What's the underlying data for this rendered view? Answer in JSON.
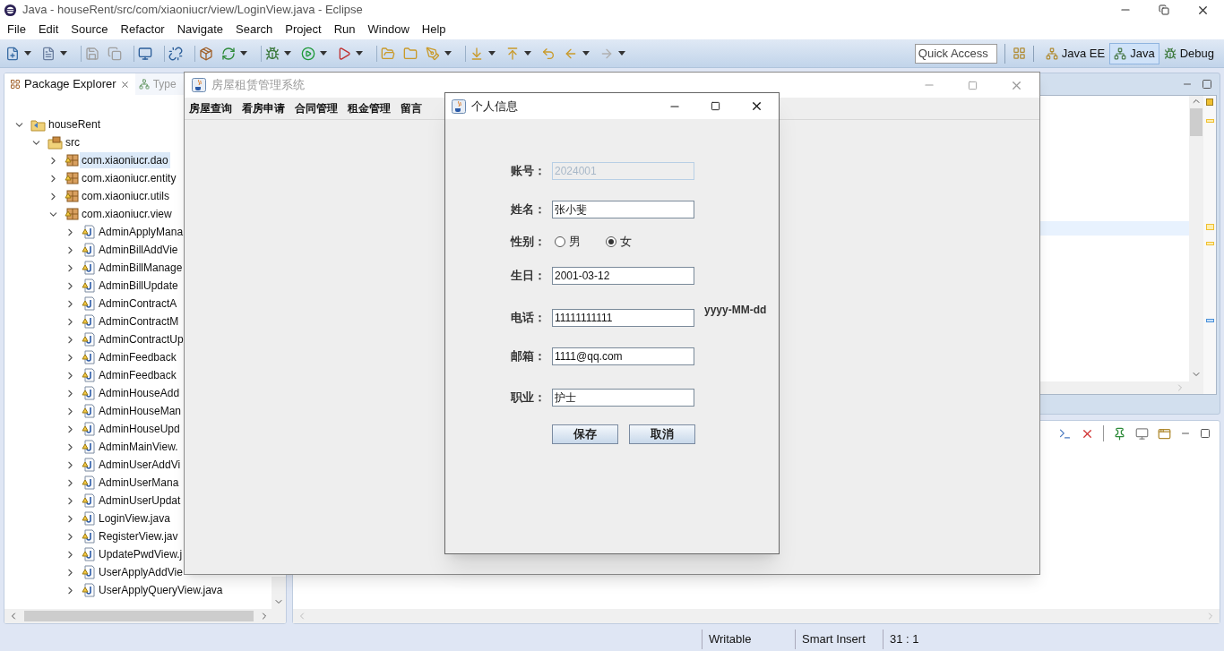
{
  "window": {
    "title": "Java - houseRent/src/com/xiaoniucr/view/LoginView.java - Eclipse"
  },
  "menu": [
    "File",
    "Edit",
    "Source",
    "Refactor",
    "Navigate",
    "Search",
    "Project",
    "Run",
    "Window",
    "Help"
  ],
  "quick_access": {
    "placeholder": "Quick Access"
  },
  "perspectives": [
    {
      "label": "Java EE",
      "selected": false
    },
    {
      "label": "Java",
      "selected": true
    },
    {
      "label": "Debug",
      "selected": false
    }
  ],
  "package_explorer": {
    "tabs": [
      {
        "label": "Package Explorer",
        "selected": true
      },
      {
        "label": "Type",
        "selected": false
      }
    ],
    "tree": [
      {
        "label": "houseRent",
        "kind": "project",
        "expanded": true,
        "selected": false,
        "children": [
          {
            "label": "src",
            "kind": "folder",
            "expanded": true,
            "selected": false,
            "children": [
              {
                "label": "com.xiaoniucr.dao",
                "kind": "package",
                "expanded": false,
                "selected": true
              },
              {
                "label": "com.xiaoniucr.entity",
                "kind": "package",
                "expanded": false,
                "selected": false
              },
              {
                "label": "com.xiaoniucr.utils",
                "kind": "package",
                "expanded": false,
                "selected": false
              },
              {
                "label": "com.xiaoniucr.view",
                "kind": "package",
                "expanded": true,
                "selected": false,
                "children": [
                  {
                    "label": "AdminApplyMana",
                    "kind": "file",
                    "expanded": false,
                    "selected": false
                  },
                  {
                    "label": "AdminBillAddVie",
                    "kind": "file",
                    "expanded": false,
                    "selected": false
                  },
                  {
                    "label": "AdminBillManage",
                    "kind": "file",
                    "expanded": false,
                    "selected": false
                  },
                  {
                    "label": "AdminBillUpdate",
                    "kind": "file",
                    "expanded": false,
                    "selected": false
                  },
                  {
                    "label": "AdminContractA",
                    "kind": "file",
                    "expanded": false,
                    "selected": false
                  },
                  {
                    "label": "AdminContractM",
                    "kind": "file",
                    "expanded": false,
                    "selected": false
                  },
                  {
                    "label": "AdminContractUp",
                    "kind": "file",
                    "expanded": false,
                    "selected": false
                  },
                  {
                    "label": "AdminFeedback",
                    "kind": "file",
                    "expanded": false,
                    "selected": false
                  },
                  {
                    "label": "AdminFeedback",
                    "kind": "file",
                    "expanded": false,
                    "selected": false
                  },
                  {
                    "label": "AdminHouseAdd",
                    "kind": "file",
                    "expanded": false,
                    "selected": false
                  },
                  {
                    "label": "AdminHouseMan",
                    "kind": "file",
                    "expanded": false,
                    "selected": false
                  },
                  {
                    "label": "AdminHouseUpd",
                    "kind": "file",
                    "expanded": false,
                    "selected": false
                  },
                  {
                    "label": "AdminMainView.",
                    "kind": "file",
                    "expanded": false,
                    "selected": false
                  },
                  {
                    "label": "AdminUserAddVi",
                    "kind": "file",
                    "expanded": false,
                    "selected": false
                  },
                  {
                    "label": "AdminUserMana",
                    "kind": "file",
                    "expanded": false,
                    "selected": false
                  },
                  {
                    "label": "AdminUserUpdat",
                    "kind": "file",
                    "expanded": false,
                    "selected": false
                  },
                  {
                    "label": "LoginView.java",
                    "kind": "file",
                    "expanded": false,
                    "selected": false
                  },
                  {
                    "label": "RegisterView.jav",
                    "kind": "file",
                    "expanded": false,
                    "selected": false
                  },
                  {
                    "label": "UpdatePwdView.j",
                    "kind": "file",
                    "expanded": false,
                    "selected": false
                  },
                  {
                    "label": "UserApplyAddVie",
                    "kind": "file",
                    "expanded": false,
                    "selected": false
                  },
                  {
                    "label": "UserApplyQueryView.java",
                    "kind": "file",
                    "expanded": false,
                    "selected": false
                  }
                ]
              }
            ]
          }
        ]
      }
    ]
  },
  "app_window": {
    "title": "房屋租赁管理系统",
    "menu": [
      "房屋查询",
      "看房申请",
      "合同管理",
      "租金管理",
      "留言"
    ]
  },
  "dialog": {
    "title": "个人信息",
    "fields": [
      {
        "kind": "text",
        "label": "账号：",
        "value": "2024001",
        "disabled": true
      },
      {
        "kind": "text",
        "label": "姓名：",
        "value": "张小斐",
        "disabled": false
      },
      {
        "kind": "radio",
        "label": "性别：",
        "options": [
          {
            "label": "男",
            "selected": false
          },
          {
            "label": "女",
            "selected": true
          }
        ]
      },
      {
        "kind": "text",
        "label": "生日：",
        "value": "2001-03-12",
        "disabled": false
      },
      {
        "kind": "text",
        "label": "电话：",
        "value": "11111111111",
        "disabled": false,
        "hint": "yyyy-MM-dd"
      },
      {
        "kind": "text",
        "label": "邮箱：",
        "value": "1111@qq.com",
        "disabled": false
      },
      {
        "kind": "text",
        "label": "职业：",
        "value": "护士",
        "disabled": false
      }
    ],
    "buttons": [
      "保存",
      "取消"
    ]
  },
  "status_bar": [
    "Writable",
    "Smart Insert",
    "31 : 1"
  ]
}
